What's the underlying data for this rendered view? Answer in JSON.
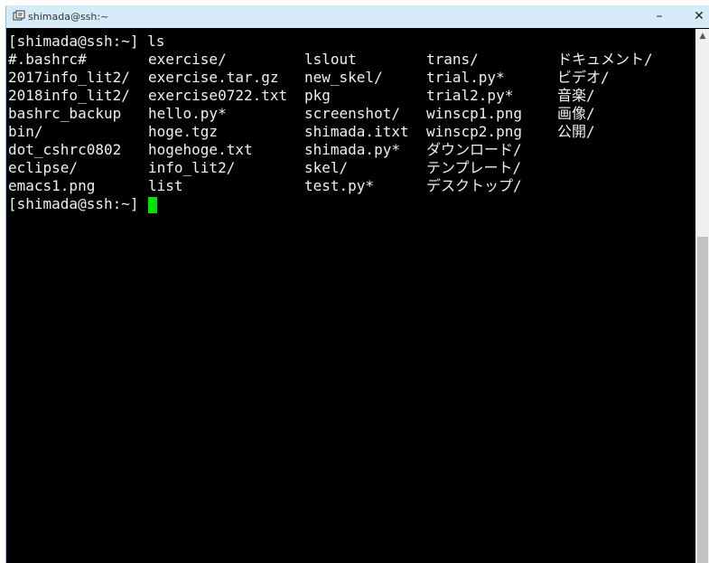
{
  "window": {
    "title": "shimada@ssh:~",
    "minimize_glyph": "–",
    "close_glyph": "✕"
  },
  "terminal": {
    "prompt_line1": "[shimada@ssh:~] ls",
    "prompt_line2": "[shimada@ssh:~] ",
    "listing": {
      "col1": [
        "#.bashrc#",
        "2017info_lit2/",
        "2018info_lit2/",
        "bashrc_backup",
        "bin/",
        "dot_cshrc0802",
        "eclipse/",
        "emacs1.png"
      ],
      "col2": [
        "exercise/",
        "exercise.tar.gz",
        "exercise0722.txt",
        "hello.py*",
        "hoge.tgz",
        "hogehoge.txt",
        "info_lit2/",
        "list"
      ],
      "col3": [
        "lslout",
        "new_skel/",
        "pkg",
        "screenshot/",
        "shimada.itxt",
        "shimada.py*",
        "skel/",
        "test.py*"
      ],
      "col4": [
        "trans/",
        "trial.py*",
        "trial2.py*",
        "winscp1.png",
        "winscp2.png",
        "ダウンロード/",
        "テンプレート/",
        "デスクトップ/"
      ],
      "col5": [
        "ドキュメント/",
        "ビデオ/",
        "音楽/",
        "画像/",
        "公開/"
      ]
    }
  },
  "scrollbar": {
    "up_glyph": "▲"
  }
}
